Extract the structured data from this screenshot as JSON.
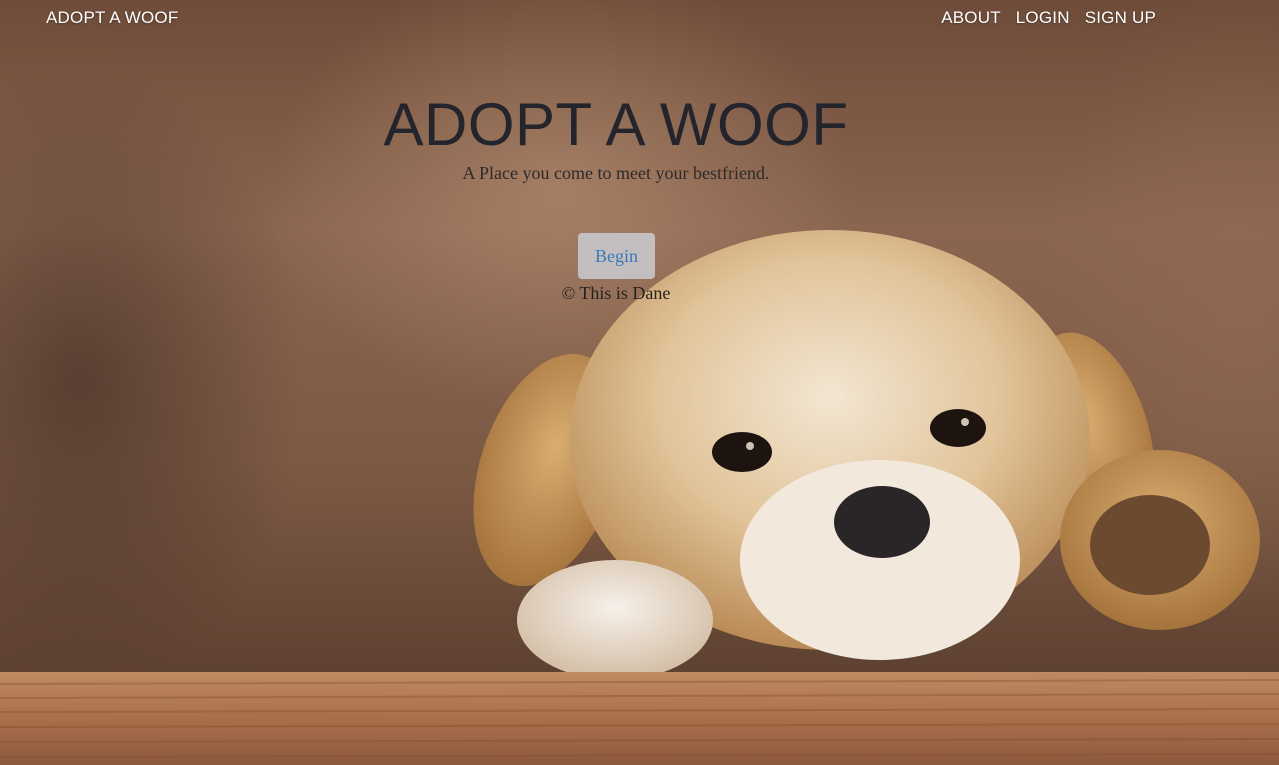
{
  "navbar": {
    "brand": "ADOPT A WOOF",
    "links": [
      "ABOUT",
      "LOGIN",
      "SIGN UP"
    ]
  },
  "hero": {
    "title": "ADOPT A WOOF",
    "subtitle": "A Place you come to meet your bestfriend.",
    "cta_label": "Begin",
    "footer_text": "© This is Dane"
  },
  "background": {
    "image": "golden-retriever-puppy-photo"
  },
  "colors": {
    "nav_text": "#ffffff",
    "title_text": "#24242c",
    "button_bg": "#c8c8cd",
    "button_text": "#3a79b8"
  }
}
